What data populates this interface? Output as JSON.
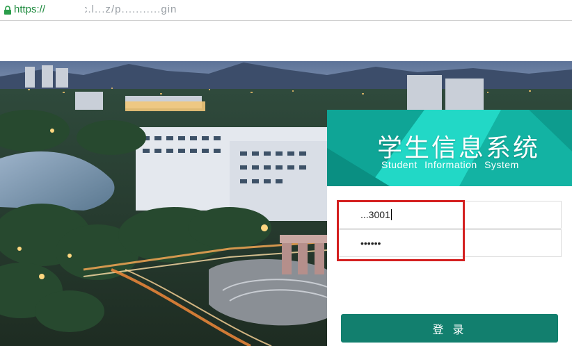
{
  "browser": {
    "scheme": "https://",
    "url_visible": "c.l...z/p...........gin"
  },
  "login": {
    "banner_title": "学生信息系统",
    "banner_subtitle": "Student Information System",
    "username_value": "...3001",
    "password_value": "••••••",
    "submit_label": "登 录"
  },
  "colors": {
    "accent": "#127f6e",
    "banner_teal": "#1ec8b8",
    "highlight": "#d42020",
    "scheme_green": "#1e8a3e"
  },
  "icons": {
    "lock": "lock-icon"
  }
}
